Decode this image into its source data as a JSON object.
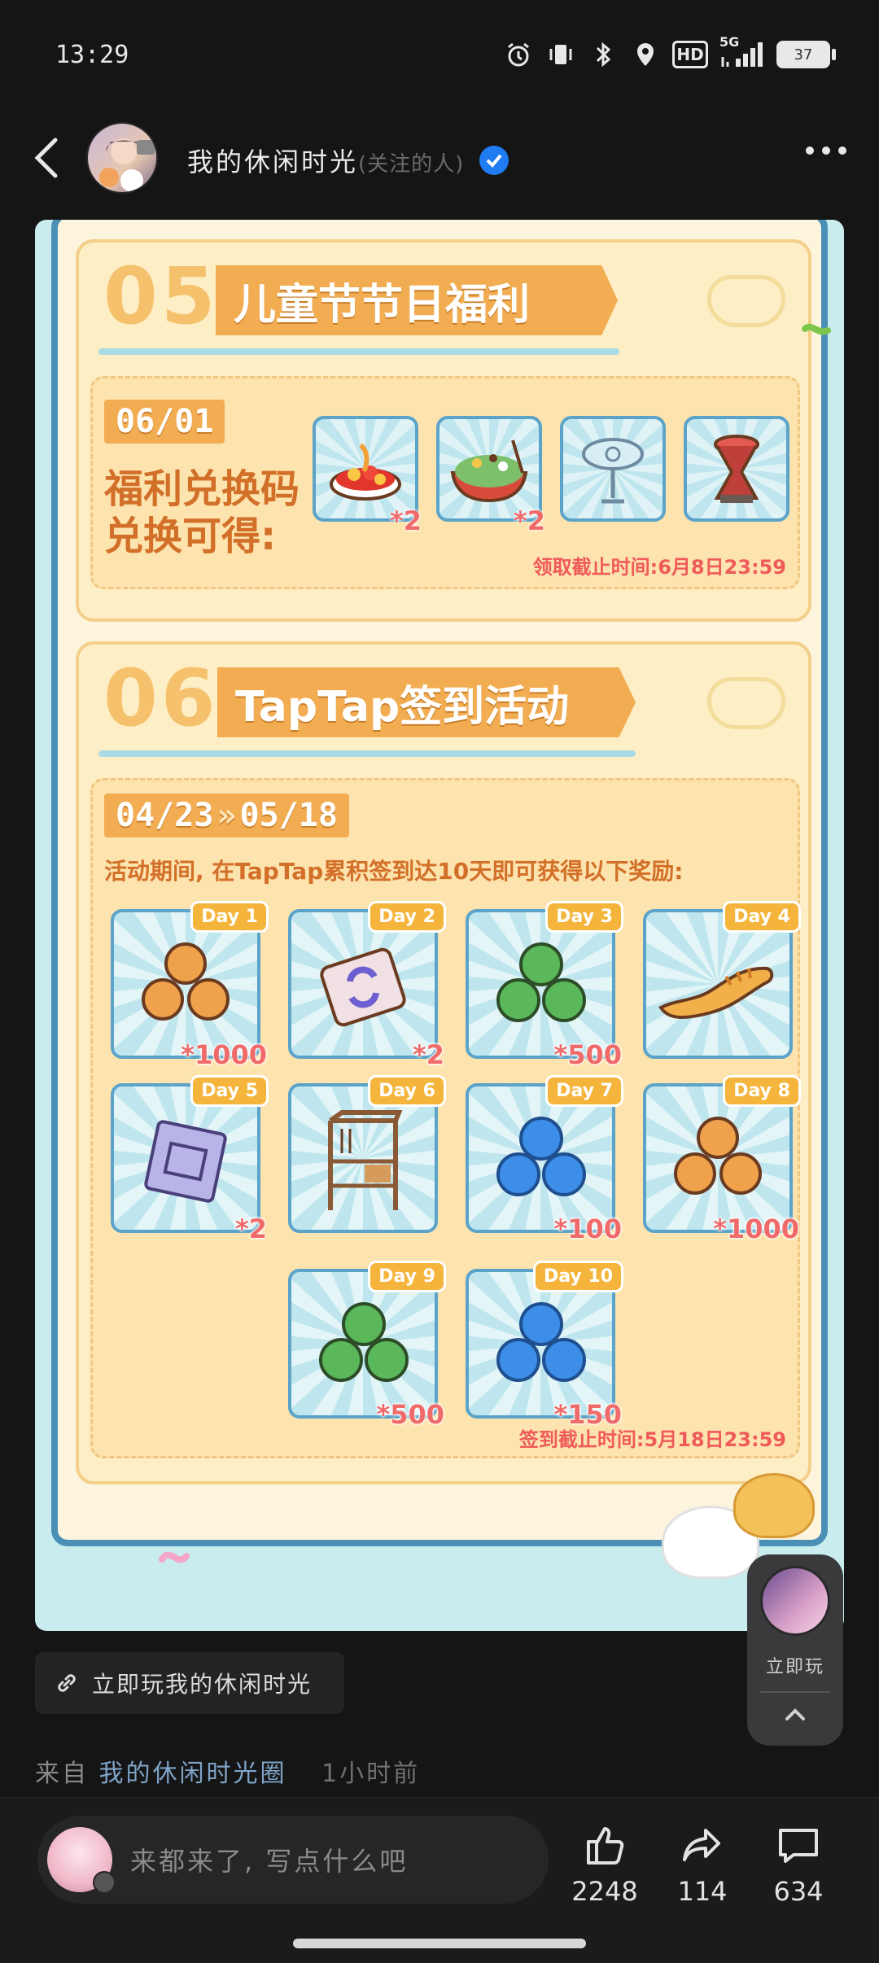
{
  "status_bar": {
    "time": "13:29",
    "hd": "HD",
    "network": "5G",
    "battery": "37"
  },
  "header": {
    "title": "我的休闲时光",
    "follow_hint": "(关注的人)"
  },
  "poster": {
    "section5": {
      "number": "05",
      "banner": "儿童节节日福利",
      "date": "06/01",
      "desc_line1": "福利兑换码",
      "desc_line2": "兑换可得:",
      "items": [
        {
          "qty": "*2"
        },
        {
          "qty": "*2"
        },
        {
          "qty": ""
        },
        {
          "qty": ""
        }
      ],
      "deadline": "领取截止时间:6月8日23:59"
    },
    "section6": {
      "number": "06",
      "banner": "TapTap签到活动",
      "date_start": "04/23",
      "date_arrow": "»",
      "date_end": "05/18",
      "desc": "活动期间, 在TapTap累积签到达10天即可获得以下奖励:",
      "days": [
        {
          "label": "Day 1",
          "qty": "*1000"
        },
        {
          "label": "Day 2",
          "qty": "*2"
        },
        {
          "label": "Day 3",
          "qty": "*500"
        },
        {
          "label": "Day 4",
          "qty": ""
        },
        {
          "label": "Day 5",
          "qty": "*2"
        },
        {
          "label": "Day 6",
          "qty": ""
        },
        {
          "label": "Day 7",
          "qty": "*100"
        },
        {
          "label": "Day 8",
          "qty": "*1000"
        },
        {
          "label": "Day 9",
          "qty": "*500"
        },
        {
          "label": "Day 10",
          "qty": "*150"
        }
      ],
      "deadline": "签到截止时间:5月18日23:59"
    }
  },
  "float_play": {
    "label": "立即玩"
  },
  "play_link": {
    "label": "立即玩我的休闲时光"
  },
  "source": {
    "prefix": "来自",
    "circle": "我的休闲时光圈",
    "time_ago": "1小时前"
  },
  "bottom_bar": {
    "comment_placeholder": "来都来了, 写点什么吧",
    "likes": "2248",
    "shares": "114",
    "comments": "634"
  }
}
